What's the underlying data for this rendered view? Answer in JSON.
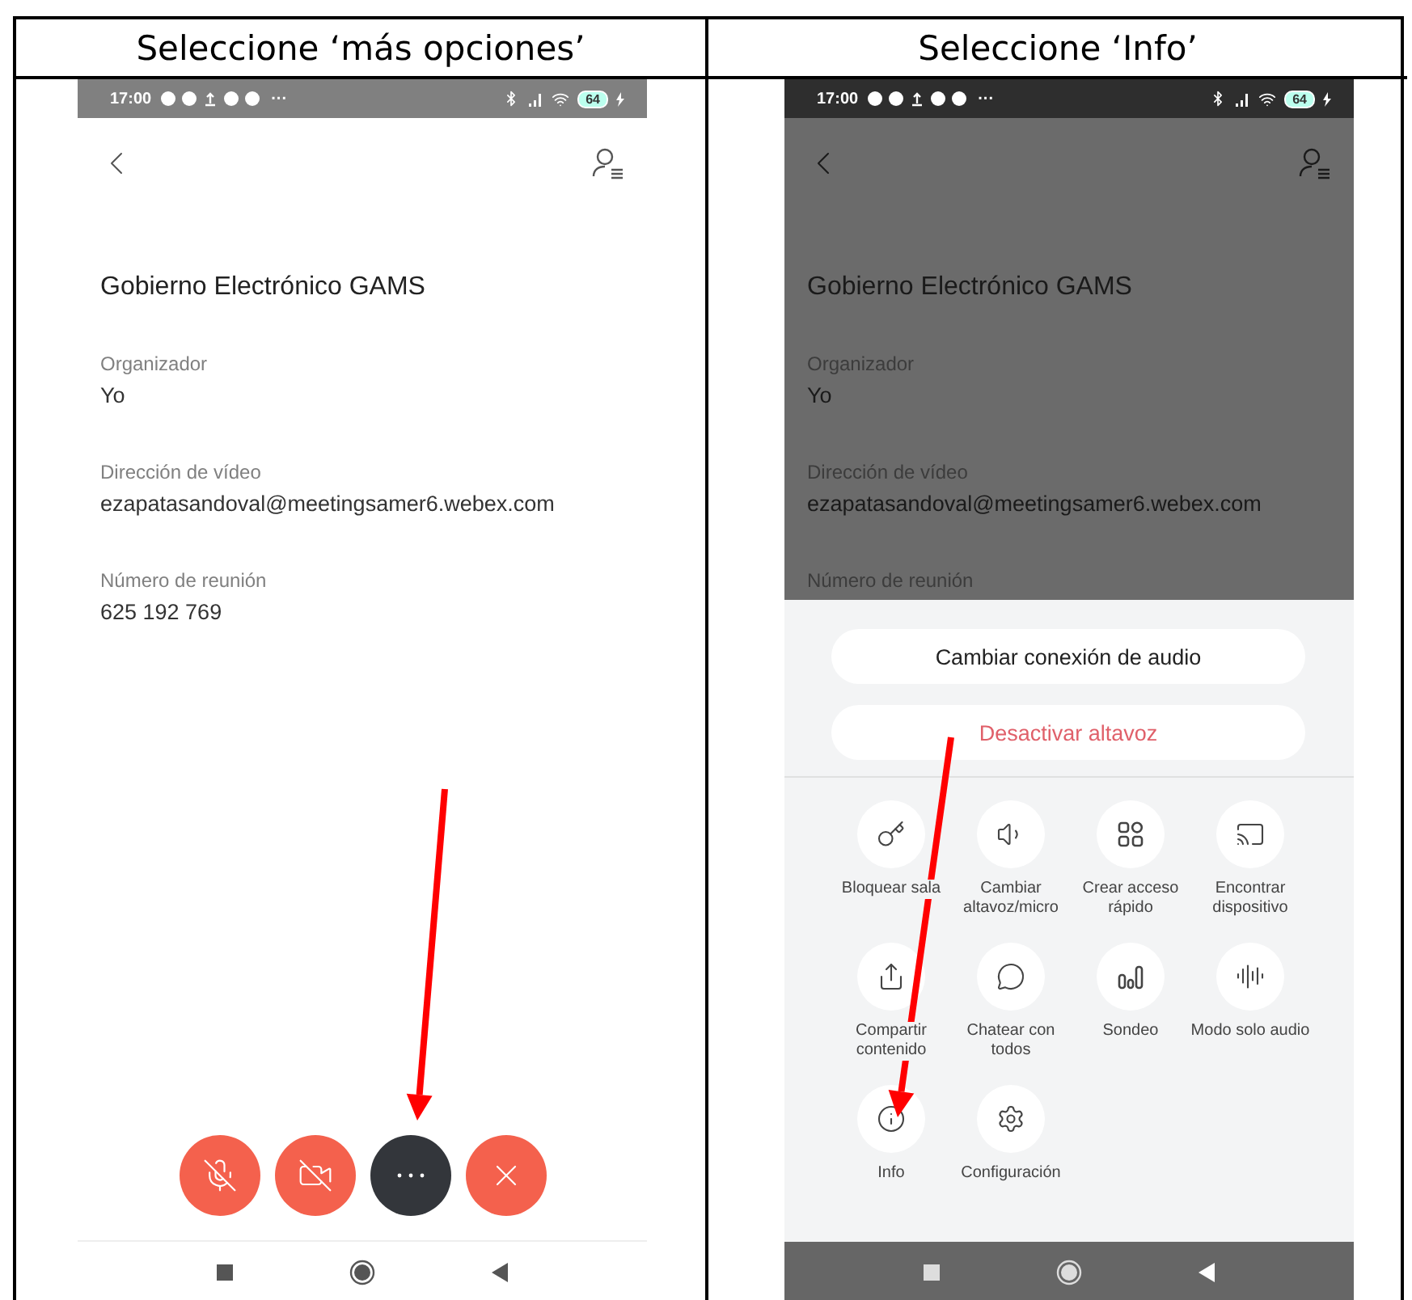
{
  "panels": [
    {
      "heading": "Seleccione ‘más opciones’",
      "dimmed": false,
      "status_bar": {
        "time": "17:00",
        "more": "···",
        "battery": "64"
      },
      "meeting": {
        "title": "Gobierno Electrónico GAMS",
        "fields": [
          {
            "label": "Organizador",
            "value": "Yo"
          },
          {
            "label": "Dirección de vídeo",
            "value": "ezapatasandoval@meetingsamer6.webex.com"
          },
          {
            "label": "Número de reunión",
            "value": "625 192 769"
          }
        ]
      },
      "call_controls": [
        {
          "kind": "mute"
        },
        {
          "kind": "video"
        },
        {
          "kind": "more"
        },
        {
          "kind": "end"
        }
      ]
    },
    {
      "heading": "Seleccione ‘Info’",
      "dimmed": true,
      "status_bar": {
        "time": "17:00",
        "more": "···",
        "battery": "64"
      },
      "meeting": {
        "title": "Gobierno Electrónico GAMS",
        "fields": [
          {
            "label": "Organizador",
            "value": "Yo"
          },
          {
            "label": "Dirección de vídeo",
            "value": "ezapatasandoval@meetingsamer6.webex.com"
          },
          {
            "label": "Número de reunión"
          }
        ]
      },
      "sheet": {
        "actions": [
          {
            "label": "Cambiar conexión de audio",
            "kind": "default"
          },
          {
            "label": "Desactivar altavoz",
            "kind": "danger"
          }
        ],
        "items": [
          {
            "label": "Bloquear sala",
            "kind": "lock"
          },
          {
            "label": "Cambiar altavoz/micro",
            "kind": "speaker"
          },
          {
            "label": "Crear acceso rápido",
            "kind": "shortcut"
          },
          {
            "label": "Encontrar dispositivo",
            "kind": "cast"
          },
          {
            "label": "Compartir contenido",
            "kind": "share"
          },
          {
            "label": "Chatear con todos",
            "kind": "chat"
          },
          {
            "label": "Sondeo",
            "kind": "poll"
          },
          {
            "label": "Modo solo audio",
            "kind": "audio"
          },
          {
            "label": "Info",
            "kind": "info"
          },
          {
            "label": "Configuración",
            "kind": "settings"
          }
        ]
      }
    }
  ]
}
